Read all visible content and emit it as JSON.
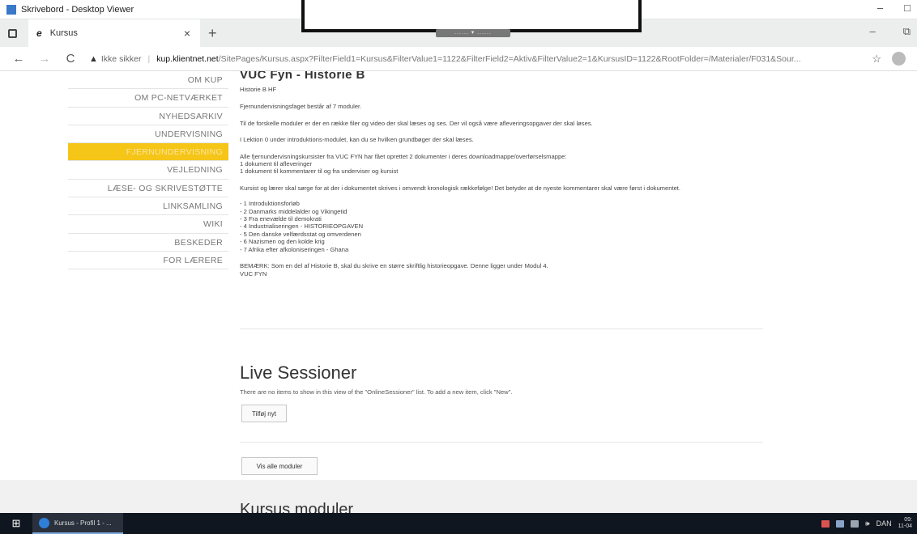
{
  "viewer": {
    "title": "Skrivebord - Desktop Viewer",
    "minimize": "–",
    "restore": "□",
    "toolbar_tab": "...... ▾ ......"
  },
  "browser": {
    "tab_title": "Kursus",
    "tab_close": "×",
    "new_tab": "+",
    "win_minimize": "–",
    "win_restore": "⧉",
    "back": "←",
    "forward": "→",
    "reload": "C",
    "warning_icon": "▲",
    "insecure_label": "Ikke sikker",
    "url_separator": "|",
    "url_host": "kup.klientnet.net",
    "url_path": "/SitePages/Kursus.aspx?FilterField1=Kursus&FilterValue1=1122&FilterField2=Aktiv&FilterValue2=1&KursusID=1122&RootFolder=/Materialer/F031&Sour...",
    "favorites_icon": "☆"
  },
  "sidebar": {
    "items": [
      {
        "label": "OM KUP"
      },
      {
        "label": "OM PC-NETVÆRKET"
      },
      {
        "label": "NYHEDSARKIV"
      },
      {
        "label": "UNDERVISNING"
      },
      {
        "label": "FJERNUNDERVISNING"
      },
      {
        "label": "VEJLEDNING"
      },
      {
        "label": "LÆSE- OG SKRIVESTØTTE"
      },
      {
        "label": "LINKSAMLING"
      },
      {
        "label": "WIKI"
      },
      {
        "label": "BESKEDER"
      },
      {
        "label": "FOR LÆRERE"
      }
    ],
    "active_color": "#f5c518"
  },
  "course": {
    "title": "VUC Fyn - Historie B",
    "subtitle": "Historie B HF",
    "p1": "Fjernundervisningsfaget består af 7 moduler.",
    "p2": "Til de forskelle moduler er der en række filer og video der skal læses og ses. Der vil også være afleveringsopgaver der skal løses.",
    "p3": "I Lektion 0 under introduktions-modulet, kan du se hvilken grundbøger der skal læses.",
    "p4_line1": "Alle fjernundervisningskursister fra VUC FYN har fået oprettet 2 dokumenter i deres downloadmappe/overførselsmappe:",
    "p4_line2": "1 dokument til afleveringer",
    "p4_line3": "1 dokument til kommentarer til og fra underviser og kursist",
    "p5": "Kursist og lærer skal sørge for at der i dokumentet skrives i omvendt kronologisk rækkefølge! Det betyder at de nyeste kommentarer skal være først i dokumentet.",
    "modules": [
      "- 1 Introduktionsforløb",
      "- 2 Danmarks middelalder og Vikingetid",
      "- 3 Fra enevælde til demokrati",
      "- 4 Industrialiseringen - HISTORIEOPGAVEN",
      "- 5 Den danske velfærdsstat og omverdenen",
      "- 6 Nazismen og den kolde krig",
      "- 7 Afrika efter afkoloniseringen - Ghana"
    ],
    "note": "BEMÆRK: Som en del af Historie B, skal du skrive en større skriftlig historieopgave. Denne ligger under Modul 4.",
    "signature": "VUC FYN"
  },
  "live": {
    "heading": "Live Sessioner",
    "empty_text": "There are no items to show in this view of the \"OnlineSessioner\" list. To add a new item, click \"New\".",
    "add_button": "Tilføj nyt"
  },
  "modules_section": {
    "show_all_button": "Vis alle moduler",
    "heading": "Kursus moduler"
  },
  "taskbar": {
    "start_icon": "⊞",
    "task_label": "Kursus - Profil 1 - ...",
    "speaker": "🕪",
    "language": "DAN",
    "time": "09:",
    "date": "11-04"
  }
}
